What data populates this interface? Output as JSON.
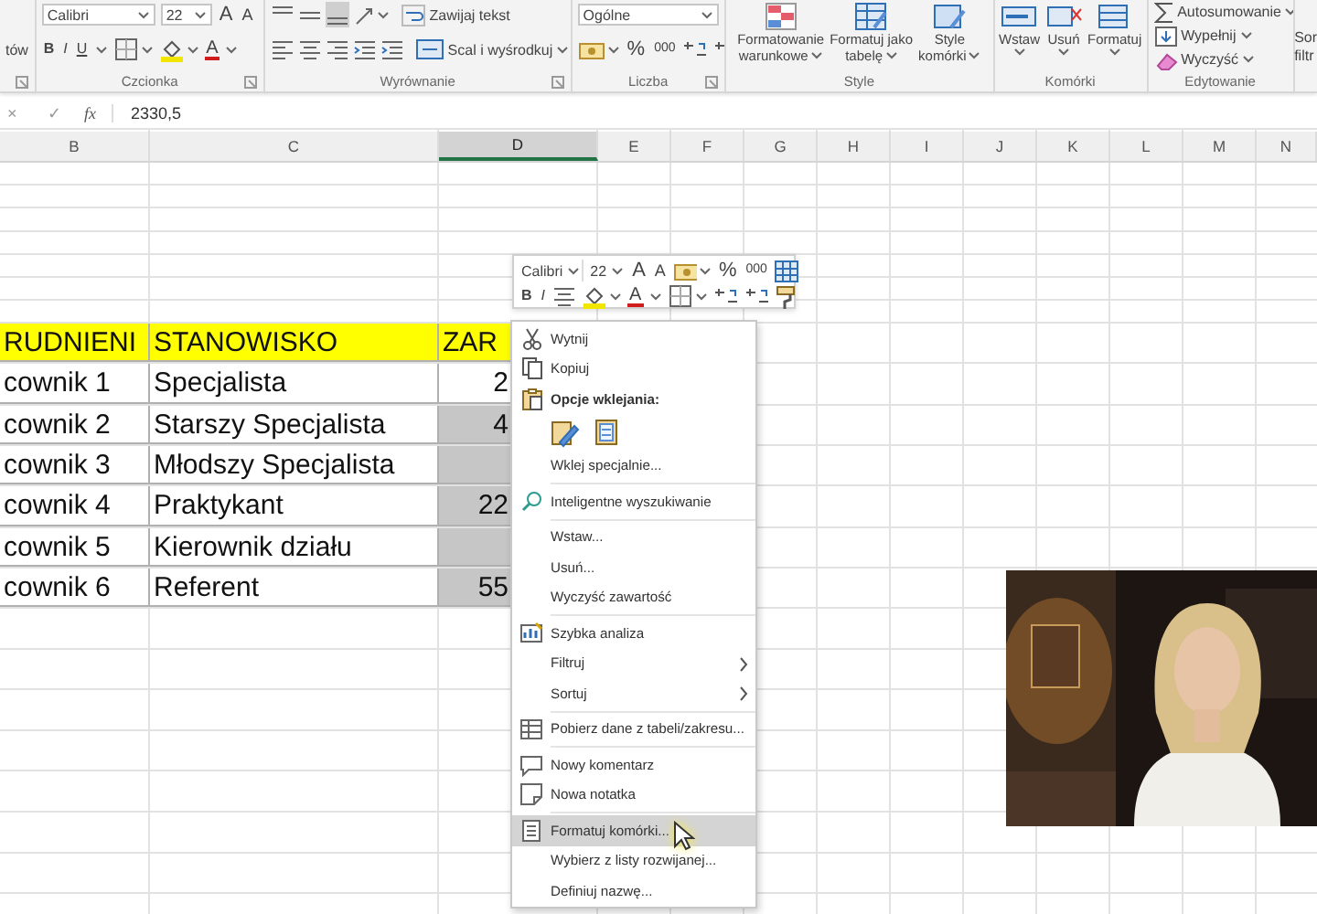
{
  "ribbon": {
    "clipboard": {
      "fragment": "tów"
    },
    "font": {
      "name": "Calibri",
      "size": "22",
      "grow_shrink": [
        "A",
        "A"
      ],
      "styles": [
        "B",
        "I",
        "U"
      ],
      "font_color": "A",
      "label": "Czcionka"
    },
    "alignment": {
      "vertical_align": [
        {
          "selected": false
        },
        {
          "selected": false
        },
        {
          "selected": true
        }
      ],
      "wrap": "Zawijaj tekst",
      "merge": "Scal i wyśrodkuj",
      "label": "Wyrównanie"
    },
    "number": {
      "format": "Ogólne",
      "percent": "%",
      "thousands": "000",
      "label": "Liczba"
    },
    "styles": {
      "buttons": [
        {
          "lines": [
            "Formatowanie",
            "warunkowe"
          ]
        },
        {
          "lines": [
            "Formatuj jako",
            "tabelę"
          ]
        },
        {
          "lines": [
            "Style",
            "komórki"
          ]
        }
      ],
      "label": "Style"
    },
    "cells": {
      "buttons": [
        "Wstaw",
        "Usuń",
        "Formatuj"
      ],
      "label": "Komórki"
    },
    "editing": {
      "items": [
        "Autosumowanie",
        "Wypełnij",
        "Wyczyść"
      ],
      "label": "Edytowanie"
    },
    "sort": {
      "lines": [
        "Sor",
        "filtr"
      ]
    }
  },
  "formula_bar": {
    "cancel": "×",
    "enter": "✓",
    "fx": "fx",
    "value": "2330,5"
  },
  "columns": [
    {
      "letter": "B",
      "selected": false
    },
    {
      "letter": "C",
      "selected": false
    },
    {
      "letter": "D",
      "selected": true
    },
    {
      "letter": "E",
      "selected": false
    },
    {
      "letter": "F",
      "selected": false
    },
    {
      "letter": "G",
      "selected": false
    },
    {
      "letter": "H",
      "selected": false
    },
    {
      "letter": "I",
      "selected": false
    },
    {
      "letter": "J",
      "selected": false
    },
    {
      "letter": "K",
      "selected": false
    },
    {
      "letter": "L",
      "selected": false
    },
    {
      "letter": "M",
      "selected": false
    },
    {
      "letter": "N",
      "selected": false
    }
  ],
  "table": {
    "rows": [
      {
        "kind": "header",
        "cells": [
          "RUDNIENI",
          "STANOWISKO",
          "ZAR"
        ],
        "value_selected": false
      },
      {
        "kind": "data",
        "cells": [
          "cownik 1",
          "Specjalista",
          "2"
        ],
        "value_selected": false
      },
      {
        "kind": "data",
        "cells": [
          "cownik 2",
          "Starszy Specjalista",
          "4"
        ],
        "value_selected": true
      },
      {
        "kind": "data",
        "cells": [
          "cownik 3",
          "Młodszy Specjalista"
        ],
        "value_selected": true
      },
      {
        "kind": "data",
        "cells": [
          "cownik 4",
          "Praktykant",
          "22"
        ],
        "value_selected": true
      },
      {
        "kind": "data",
        "cells": [
          "cownik 5",
          "Kierownik działu"
        ],
        "value_selected": true
      },
      {
        "kind": "data",
        "cells": [
          "cownik 6",
          "Referent",
          "55"
        ],
        "value_selected": true
      }
    ]
  },
  "mini_toolbar": {
    "font": "Calibri",
    "size": "22",
    "grow_shrink": [
      "A",
      "A"
    ],
    "percent": "%",
    "thousands": "000",
    "bold": "B",
    "italic": "I",
    "font_color": "A"
  },
  "context_menu": {
    "items": [
      {
        "kind": "item",
        "label": "Wytnij",
        "selected": false,
        "submenu": false
      },
      {
        "kind": "item",
        "label": "Kopiuj",
        "selected": false,
        "submenu": false
      },
      {
        "kind": "heading",
        "label": "Opcje wklejania:"
      },
      {
        "kind": "paste_options"
      },
      {
        "kind": "item",
        "label": "Wklej specjalnie...",
        "selected": false,
        "submenu": false
      },
      {
        "kind": "separator"
      },
      {
        "kind": "item",
        "label": "Inteligentne wyszukiwanie",
        "selected": false,
        "submenu": false
      },
      {
        "kind": "separator"
      },
      {
        "kind": "item",
        "label": "Wstaw...",
        "selected": false,
        "submenu": false
      },
      {
        "kind": "item",
        "label": "Usuń...",
        "selected": false,
        "submenu": false
      },
      {
        "kind": "item",
        "label": "Wyczyść zawartość",
        "selected": false,
        "submenu": false
      },
      {
        "kind": "separator"
      },
      {
        "kind": "item",
        "label": "Szybka analiza",
        "selected": false,
        "submenu": false
      },
      {
        "kind": "item",
        "label": "Filtruj",
        "selected": false,
        "submenu": true
      },
      {
        "kind": "item",
        "label": "Sortuj",
        "selected": false,
        "submenu": true
      },
      {
        "kind": "separator"
      },
      {
        "kind": "item",
        "label": "Pobierz dane z tabeli/zakresu...",
        "selected": false,
        "submenu": false
      },
      {
        "kind": "separator"
      },
      {
        "kind": "item",
        "label": "Nowy komentarz",
        "selected": false,
        "submenu": false
      },
      {
        "kind": "item",
        "label": "Nowa notatka",
        "selected": false,
        "submenu": false
      },
      {
        "kind": "separator"
      },
      {
        "kind": "item",
        "label": "Formatuj komórki...",
        "selected": true,
        "submenu": false
      },
      {
        "kind": "item",
        "label": "Wybierz z listy rozwijanej...",
        "selected": false,
        "submenu": false
      },
      {
        "kind": "item",
        "label": "Definiuj nazwę...",
        "selected": false,
        "submenu": false
      }
    ]
  }
}
